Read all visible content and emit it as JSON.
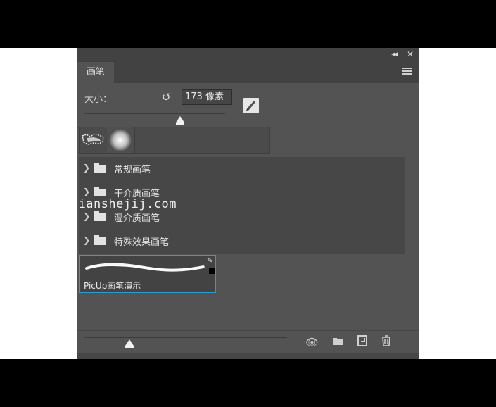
{
  "panel": {
    "tab_label": "画笔",
    "icons": {
      "collapse": "double-chevron-left-icon",
      "close": "close-icon",
      "menu": "hamburger-menu-icon"
    }
  },
  "size": {
    "label": "大小：",
    "value": "173 像素",
    "slider_fraction": 0.67
  },
  "folders": [
    {
      "label": "常规画笔"
    },
    {
      "label": "干介质画笔"
    },
    {
      "label": "湿介质画笔"
    },
    {
      "label": "特殊效果画笔"
    }
  ],
  "preset": {
    "label": "PicUp画笔演示",
    "selected": true
  },
  "watermark": "idianshejij.com",
  "bottom_toolbar": {
    "thumbnail_size_fraction": 0.22,
    "icons": [
      "toggle-brush-visibility-icon",
      "new-group-icon",
      "new-brush-icon",
      "delete-icon"
    ]
  },
  "colors": {
    "panel": "#535353",
    "panel_dark": "#424242",
    "selection_border": "#2e9ad0"
  }
}
